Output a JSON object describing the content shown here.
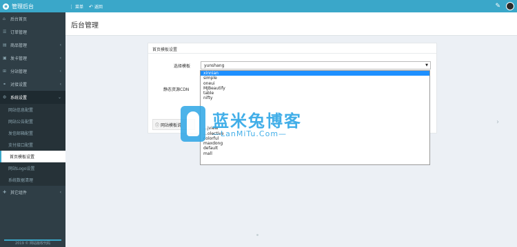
{
  "topbar": {
    "brand_title": "管理后台",
    "menu_label": "菜单",
    "back_label": "返回",
    "accent": "#3aa7c9"
  },
  "sidebar": {
    "items": [
      {
        "label": "后台首页",
        "icon": "home-icon",
        "glyph": "⌂",
        "chevron": false
      },
      {
        "label": "订单管理",
        "icon": "list-icon",
        "glyph": "☰",
        "chevron": false
      },
      {
        "label": "商品管理",
        "icon": "cart-icon",
        "glyph": "▤",
        "chevron": true
      },
      {
        "label": "发卡管理",
        "icon": "card-icon",
        "glyph": "▣",
        "chevron": true
      },
      {
        "label": "分站管理",
        "icon": "branch-icon",
        "glyph": "⊞",
        "chevron": true
      },
      {
        "label": "对接设置",
        "icon": "link-icon",
        "glyph": "⚭",
        "chevron": true
      },
      {
        "label": "系统设置",
        "icon": "gear-icon",
        "glyph": "⚙",
        "chevron": true
      }
    ],
    "sub_items": [
      {
        "label": "网站信息配置"
      },
      {
        "label": "网站公告配置"
      },
      {
        "label": "发信邮箱配置"
      },
      {
        "label": "支付接口配置"
      },
      {
        "label": "首页模板设置"
      },
      {
        "label": "网站Logo设置"
      },
      {
        "label": "系统数据清理"
      }
    ],
    "other": {
      "label": "其它组件",
      "icon": "puzzle-icon",
      "glyph": "✚"
    },
    "footer": "2019 © 网站版权代码"
  },
  "header": {
    "title": "后台管理"
  },
  "panel": {
    "title": "首页模板设置",
    "select_label": "选择模板",
    "selected_value": "yunshang",
    "cdn_label": "静态资源CDN",
    "info_text": "网站模板说"
  },
  "dropdown": {
    "options": [
      "xinnian",
      "simple",
      "oneui",
      "MJBeautify",
      "table",
      "nifty",
      "",
      "",
      "",
      "",
      "",
      "…jview",
      "…olective",
      "colorful",
      "maxdong",
      "default",
      "mall"
    ],
    "highlighted_index": 0
  },
  "watermark": {
    "title": "蓝米兔博客",
    "subtitle": "—LanMiTu.Com—"
  }
}
